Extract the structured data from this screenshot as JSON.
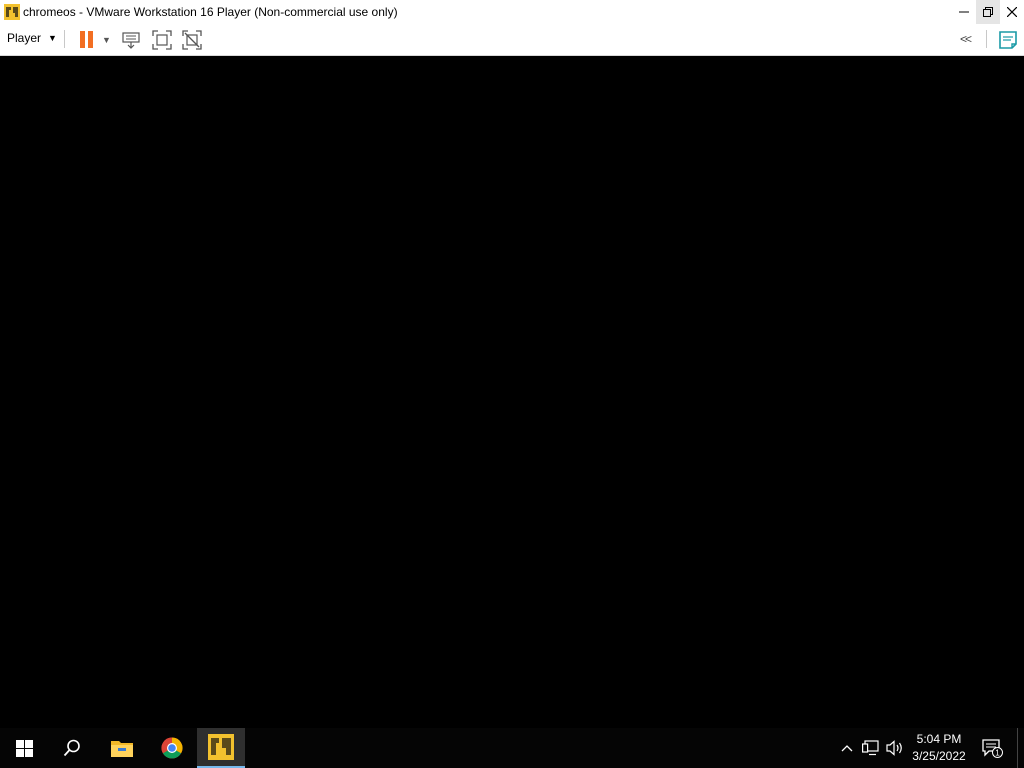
{
  "window": {
    "title": "chromeos - VMware Workstation 16 Player (Non-commercial use only)",
    "app_icon": "vmware-icon",
    "controls": [
      "minimize-icon",
      "restore-icon",
      "close-icon"
    ]
  },
  "toolbar": {
    "player_menu_label": "Player",
    "icons": [
      "pause-icon",
      "dropdown-caret-icon",
      "send-ctrl-alt-del-icon",
      "full-screen-icon",
      "unity-icon",
      "collapse-toolbar-icon",
      "message-log-icon"
    ],
    "accent_color": "#f26e22"
  },
  "taskbar": {
    "items": [
      "windows-start-icon",
      "search-icon",
      "file-explorer-icon",
      "chrome-icon",
      "vmware-player-icon"
    ],
    "tray_icons": [
      "show-hidden-icons-chevron",
      "network-icon",
      "volume-icon"
    ],
    "clock": {
      "time": "5:04 PM",
      "date": "3/25/2022"
    },
    "notification_count": "1"
  }
}
